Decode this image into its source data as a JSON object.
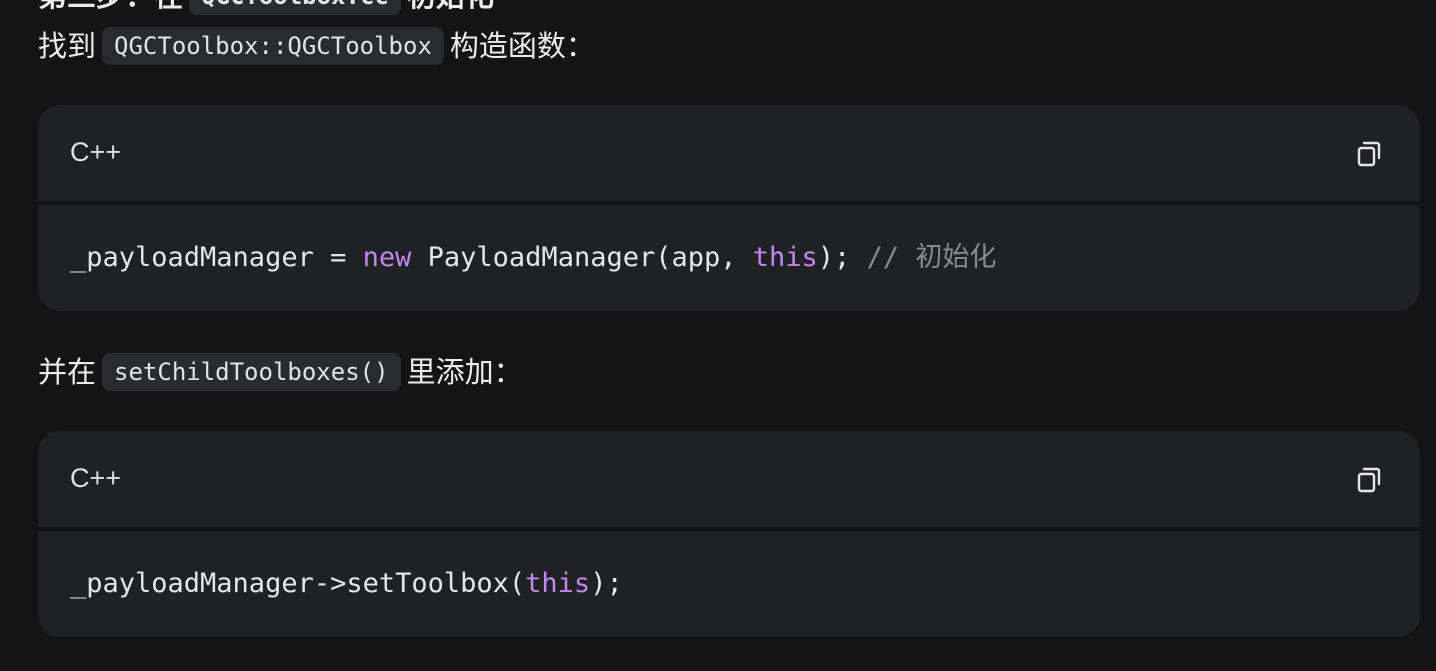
{
  "heading_partial": {
    "prefix": "第三步：在",
    "code": "QGCToolbox.cc",
    "suffix": "初始化"
  },
  "para1": {
    "prefix": "找到",
    "code": "QGCToolbox::QGCToolbox",
    "suffix": "构造函数："
  },
  "code_block_1": {
    "language": "C++",
    "tokens": {
      "t1": "_payloadManager = ",
      "t2": "new",
      "t3": " PayloadManager(app, ",
      "t4": "this",
      "t5": "); ",
      "t6": "// 初始化"
    }
  },
  "para2": {
    "prefix": "并在",
    "code": "setChildToolboxes()",
    "suffix": "里添加："
  },
  "code_block_2": {
    "language": "C++",
    "tokens": {
      "t1": "_payloadManager->setToolbox(",
      "t2": "this",
      "t3": ");"
    }
  },
  "icons": {
    "copy": "copy-icon"
  },
  "colors": {
    "background": "#141414",
    "code_bg": "#202123",
    "keyword": "#c586f5",
    "comment": "#8a8a8a"
  }
}
